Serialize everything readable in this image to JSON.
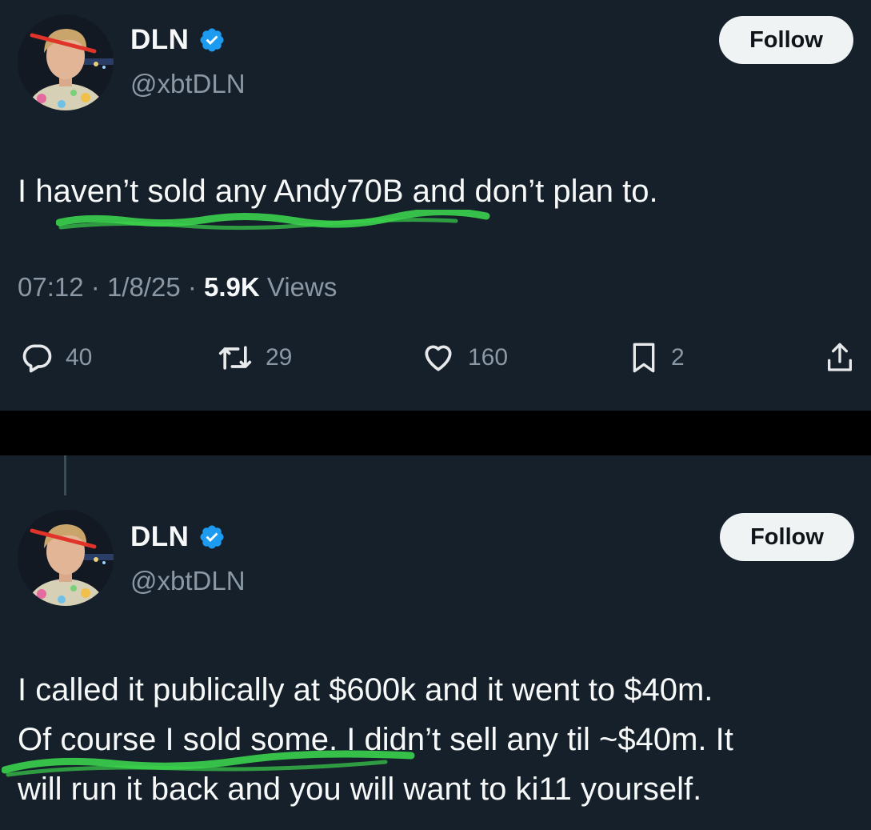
{
  "colors": {
    "background": "#15202b",
    "separator": "#000000",
    "text": "#e7e9ea",
    "muted": "#8b98a5",
    "verified": "#1d9bf0",
    "follow_bg": "#eff3f4",
    "scribble": "#3bd14c"
  },
  "tweets": [
    {
      "author": {
        "name": "DLN",
        "handle": "@xbtDLN",
        "verified_icon": "verified-badge-icon"
      },
      "follow_label": "Follow",
      "text_lines": [
        "I haven’t sold any Andy70B and don’t plan to."
      ],
      "meta": {
        "time": "07:12",
        "date": "1/8/25",
        "views_count": "5.9K",
        "views_label": "Views"
      },
      "actions": {
        "replies": "40",
        "reposts": "29",
        "likes": "160",
        "bookmarks": "2"
      }
    },
    {
      "author": {
        "name": "DLN",
        "handle": "@xbtDLN",
        "verified_icon": "verified-badge-icon"
      },
      "follow_label": "Follow",
      "text_lines": [
        "I called it publically at $600k and it went to $40m.",
        "Of course I sold some. I didn’t sell any til ~$40m. It",
        "will run it back and you will want to ki11 yourself."
      ]
    }
  ]
}
